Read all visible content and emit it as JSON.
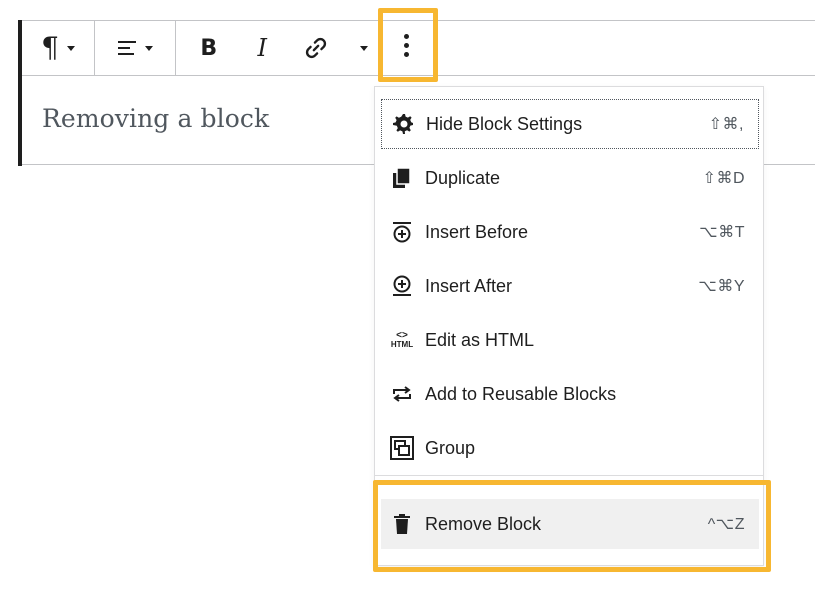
{
  "block": {
    "text": "Removing a block"
  },
  "toolbar": {
    "paragraph_icon": "¶",
    "bold_icon": "B",
    "italic_icon": "I"
  },
  "menu": {
    "items": [
      {
        "label": "Hide Block Settings",
        "shortcut": "⇧⌘,",
        "icon": "gear-icon"
      },
      {
        "label": "Duplicate",
        "shortcut": "⇧⌘D",
        "icon": "duplicate-icon"
      },
      {
        "label": "Insert Before",
        "shortcut": "⌥⌘T",
        "icon": "insert-before-icon"
      },
      {
        "label": "Insert After",
        "shortcut": "⌥⌘Y",
        "icon": "insert-after-icon"
      },
      {
        "label": "Edit as HTML",
        "shortcut": "",
        "icon": "html-icon"
      },
      {
        "label": "Add to Reusable Blocks",
        "shortcut": "",
        "icon": "reusable-icon"
      },
      {
        "label": "Group",
        "shortcut": "",
        "icon": "group-icon"
      }
    ],
    "remove": {
      "label": "Remove Block",
      "shortcut": "^⌥Z",
      "icon": "trash-icon"
    }
  },
  "html_icon_text": {
    "top": "<>",
    "bottom": "HTML"
  },
  "colors": {
    "highlight": "#f7b731",
    "text": "#1e1e1e",
    "muted": "#50575e",
    "border": "#c3c4c7"
  }
}
